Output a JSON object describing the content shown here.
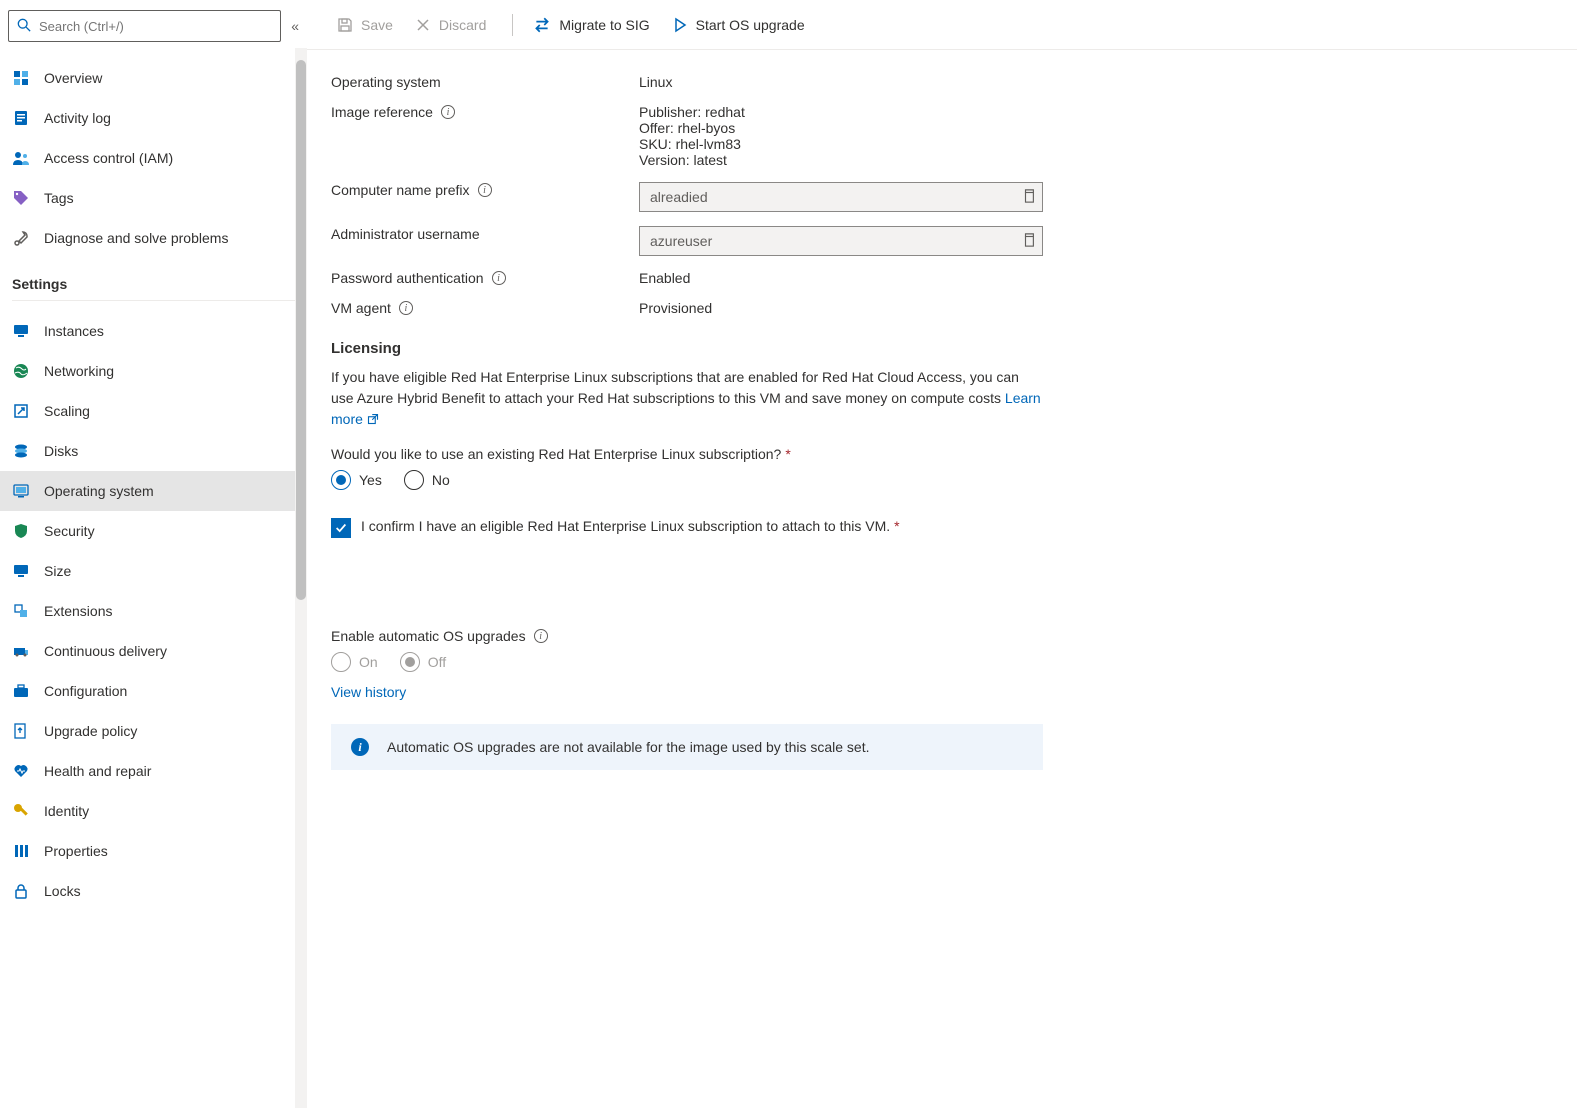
{
  "search": {
    "placeholder": "Search (Ctrl+/)"
  },
  "nav": {
    "top": [
      {
        "label": "Overview"
      },
      {
        "label": "Activity log"
      },
      {
        "label": "Access control (IAM)"
      },
      {
        "label": "Tags"
      },
      {
        "label": "Diagnose and solve problems"
      }
    ],
    "settings_title": "Settings",
    "settings": [
      {
        "label": "Instances"
      },
      {
        "label": "Networking"
      },
      {
        "label": "Scaling"
      },
      {
        "label": "Disks"
      },
      {
        "label": "Operating system"
      },
      {
        "label": "Security"
      },
      {
        "label": "Size"
      },
      {
        "label": "Extensions"
      },
      {
        "label": "Continuous delivery"
      },
      {
        "label": "Configuration"
      },
      {
        "label": "Upgrade policy"
      },
      {
        "label": "Health and repair"
      },
      {
        "label": "Identity"
      },
      {
        "label": "Properties"
      },
      {
        "label": "Locks"
      }
    ]
  },
  "toolbar": {
    "save": "Save",
    "discard": "Discard",
    "migrate": "Migrate to SIG",
    "start_upgrade": "Start OS upgrade"
  },
  "os": {
    "os_label": "Operating system",
    "os_value": "Linux",
    "imgref_label": "Image reference",
    "imgref_lines": {
      "publisher": "Publisher: redhat",
      "offer": "Offer: rhel-byos",
      "sku": "SKU: rhel-lvm83",
      "version": "Version: latest"
    },
    "prefix_label": "Computer name prefix",
    "prefix_value": "alreadied",
    "admin_label": "Administrator username",
    "admin_value": "azureuser",
    "pwauth_label": "Password authentication",
    "pwauth_value": "Enabled",
    "vmagent_label": "VM agent",
    "vmagent_value": "Provisioned"
  },
  "licensing": {
    "title": "Licensing",
    "desc": "If you have eligible Red Hat Enterprise Linux subscriptions that are enabled for Red Hat Cloud Access, you can use Azure Hybrid Benefit to attach your Red Hat subscriptions to this VM and save money on compute costs ",
    "learn_more": "Learn more",
    "question": "Would you like to use an existing Red Hat Enterprise Linux subscription?",
    "yes": "Yes",
    "no": "No",
    "confirm": "I confirm I have an eligible Red Hat Enterprise Linux subscription to attach to this VM."
  },
  "auto": {
    "label": "Enable automatic OS upgrades",
    "on": "On",
    "off": "Off",
    "view_history": "View history",
    "info": "Automatic OS upgrades are not available for the image used by this scale set."
  }
}
